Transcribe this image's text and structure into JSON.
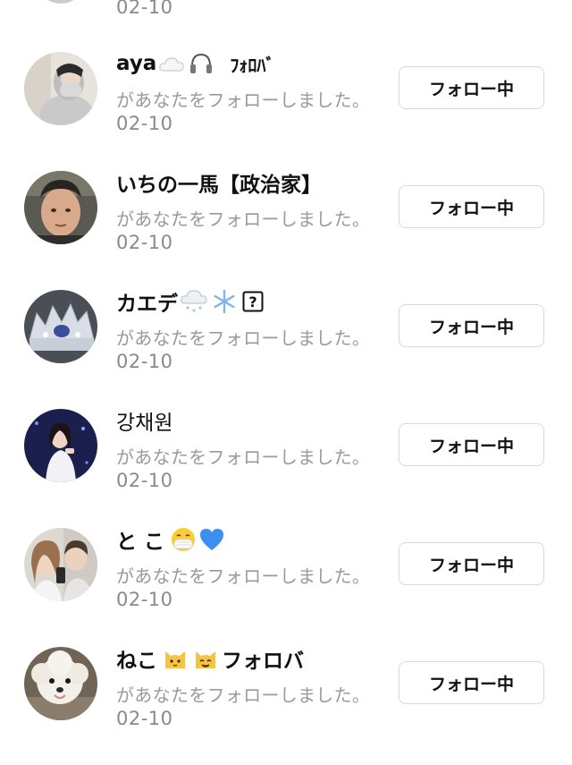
{
  "top_date": "02-10",
  "follow_button_label": "フォロー中",
  "message": "があなたをフォローしました。",
  "items": [
    {
      "name": "aya",
      "name_suffix": "ﾌｫﾛﾊﾞ",
      "date": "02-10",
      "emoji_icons": [
        "cloud-icon",
        "headphones-icon"
      ]
    },
    {
      "name": "いちの一馬【政治家】",
      "date": "02-10",
      "emoji_icons": []
    },
    {
      "name": "カエデ",
      "date": "02-10",
      "emoji_icons": [
        "snow-cloud-icon",
        "snowflake-icon",
        "unknown-char-icon"
      ]
    },
    {
      "name": "강채원",
      "date": "02-10",
      "emoji_icons": []
    },
    {
      "name": "と こ",
      "date": "02-10",
      "emoji_icons": [
        "mask-face-icon",
        "blue-heart-icon"
      ]
    },
    {
      "name": "ねこ",
      "name_suffix": "フォロバ",
      "date": "02-10",
      "emoji_icons": [
        "cat-face-icon",
        "cat-face-icon"
      ]
    }
  ]
}
